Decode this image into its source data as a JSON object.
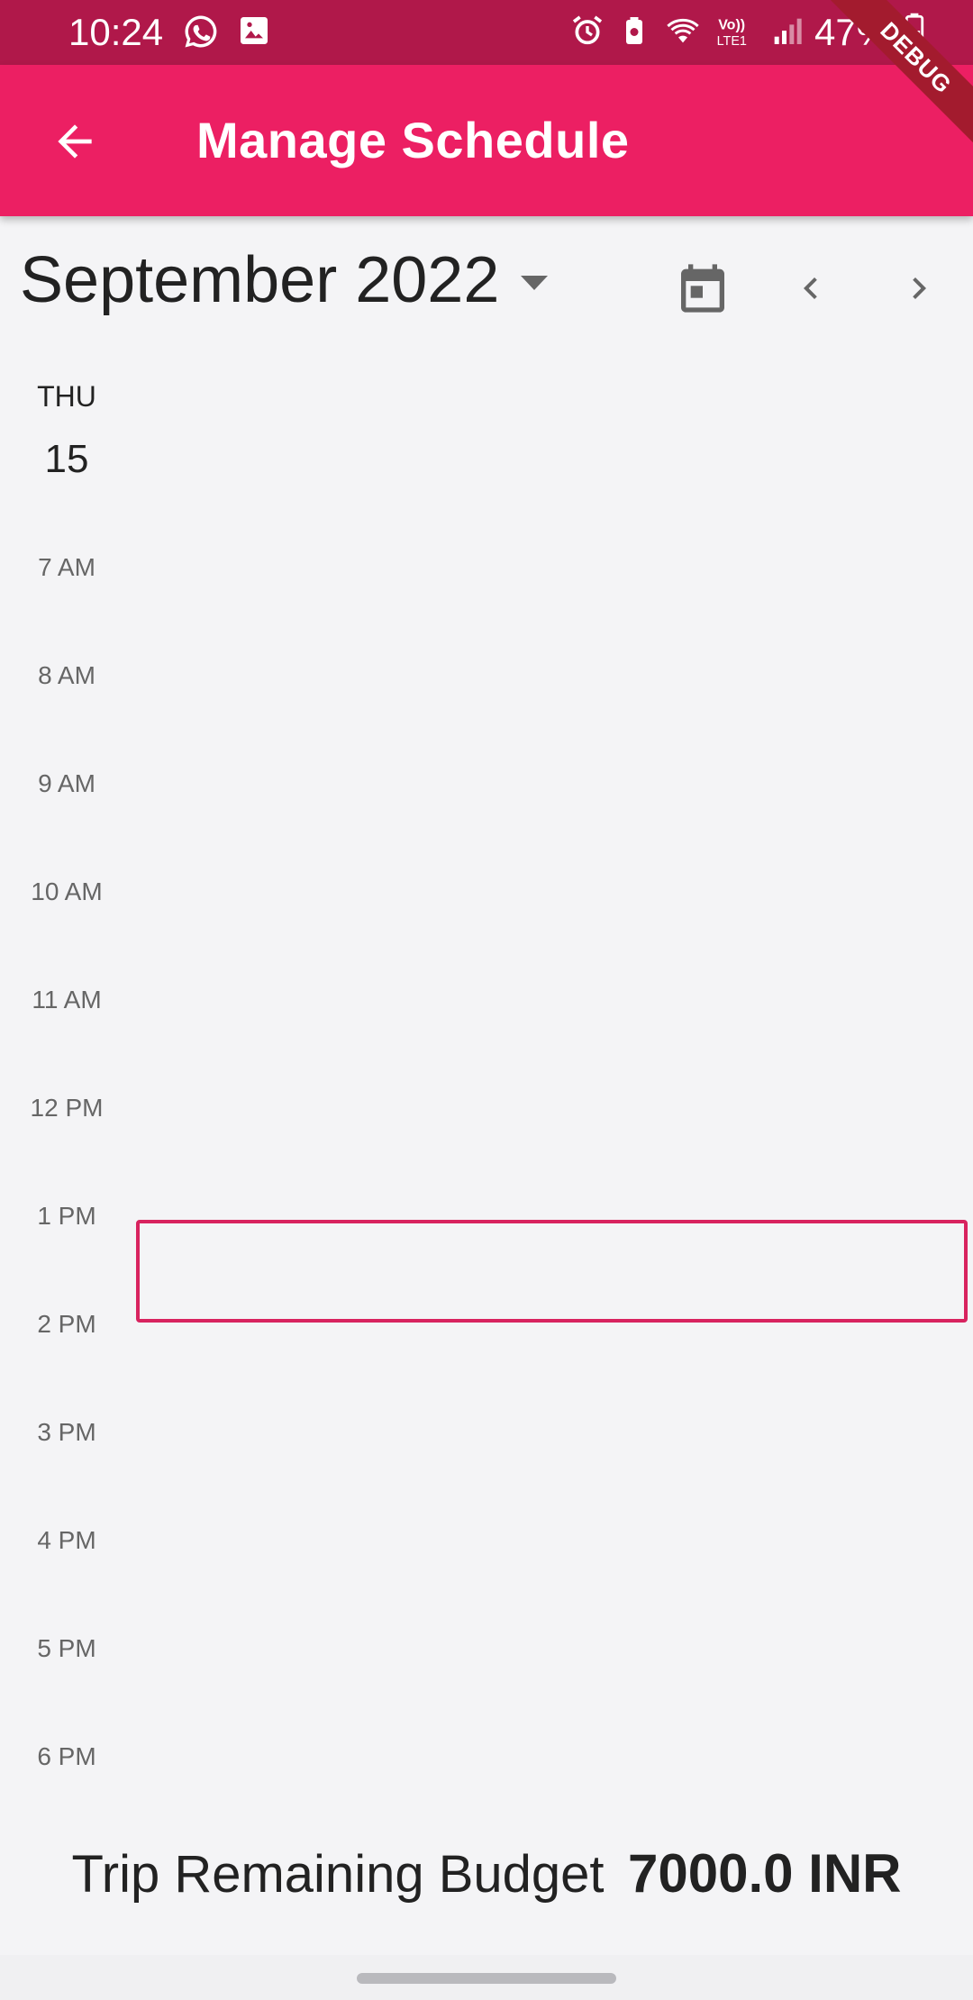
{
  "status_bar": {
    "time": "10:24",
    "battery": "47%",
    "icons": [
      "whatsapp-icon",
      "gallery-icon",
      "alarm-icon",
      "battery-saver-icon",
      "wifi-icon",
      "volte-icon",
      "signal-icon",
      "battery-icon"
    ]
  },
  "app_bar": {
    "title": "Manage Schedule",
    "debug_banner": "DEBUG",
    "background_color": "#ec1f63"
  },
  "calendar": {
    "month": "September 2022",
    "day_name": "THU",
    "day_number": "15",
    "time_slots": [
      "7 AM",
      "8 AM",
      "9 AM",
      "10 AM",
      "11 AM",
      "12 PM",
      "1 PM",
      "2 PM",
      "3 PM",
      "4 PM",
      "5 PM",
      "6 PM"
    ],
    "event_border_color": "#d8235f"
  },
  "budget": {
    "label": "Trip Remaining Budget",
    "value": "7000.0 INR"
  }
}
